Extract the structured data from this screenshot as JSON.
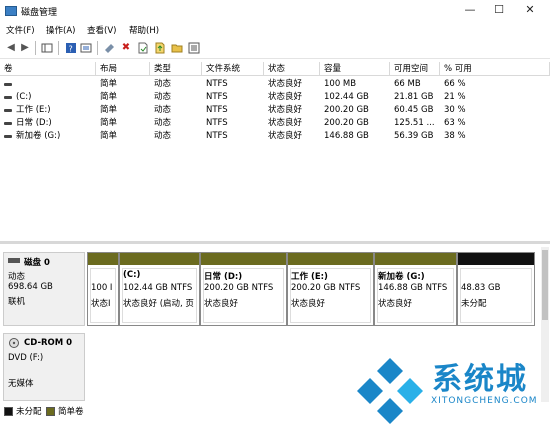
{
  "window": {
    "title": "磁盘管理",
    "minimize": "—",
    "maximize": "☐",
    "close": "✕"
  },
  "menu": [
    "文件(F)",
    "操作(A)",
    "查看(V)",
    "帮助(H)"
  ],
  "toolbar": [
    "back-icon",
    "forward-icon",
    "console-tree-icon",
    "help-icon",
    "properties-icon",
    "connect-icon",
    "delete-icon",
    "document-icon",
    "export-icon",
    "folder-icon",
    "list-icon"
  ],
  "table": {
    "headers": [
      "卷",
      "布局",
      "类型",
      "文件系统",
      "状态",
      "容量",
      "可用空间",
      "% 可用"
    ],
    "rows": [
      [
        "",
        "简单",
        "动态",
        "NTFS",
        "状态良好",
        "100 MB",
        "66 MB",
        "66 %"
      ],
      [
        "(C:)",
        "简单",
        "动态",
        "NTFS",
        "状态良好",
        "102.44 GB",
        "21.81 GB",
        "21 %"
      ],
      [
        "工作 (E:)",
        "简单",
        "动态",
        "NTFS",
        "状态良好",
        "200.20 GB",
        "60.45 GB",
        "30 %"
      ],
      [
        "日常 (D:)",
        "简单",
        "动态",
        "NTFS",
        "状态良好",
        "200.20 GB",
        "125.51 ...",
        "63 %"
      ],
      [
        "新加卷 (G:)",
        "简单",
        "动态",
        "NTFS",
        "状态良好",
        "146.88 GB",
        "56.39 GB",
        "38 %"
      ]
    ]
  },
  "disk0": {
    "name": "磁盘 0",
    "type": "动态",
    "size": "698.64 GB",
    "status": "联机",
    "partitions": [
      {
        "title": "",
        "size": "100 I",
        "status": "状态I",
        "bar": "simple"
      },
      {
        "title": "(C:)",
        "size": "102.44 GB NTFS",
        "status": "状态良好 (启动, 页",
        "bar": "simple"
      },
      {
        "title": "日常  (D:)",
        "size": "200.20 GB NTFS",
        "status": "状态良好",
        "bar": "simple"
      },
      {
        "title": "工作  (E:)",
        "size": "200.20 GB NTFS",
        "status": "状态良好",
        "bar": "simple"
      },
      {
        "title": "新加卷  (G:)",
        "size": "146.88 GB NTFS",
        "status": "状态良好",
        "bar": "simple"
      },
      {
        "title": "",
        "size": "48.83 GB",
        "status": "未分配",
        "bar": "unalloc"
      }
    ]
  },
  "cdrom0": {
    "name": "CD-ROM 0",
    "drive": "DVD (F:)",
    "media": "无媒体"
  },
  "legend": [
    {
      "label": "未分配",
      "color": "#111111"
    },
    {
      "label": "简单卷",
      "color": "#6b6b1f"
    }
  ],
  "watermark": {
    "text": "系统城",
    "sub": "XITONGCHENG.COM"
  }
}
